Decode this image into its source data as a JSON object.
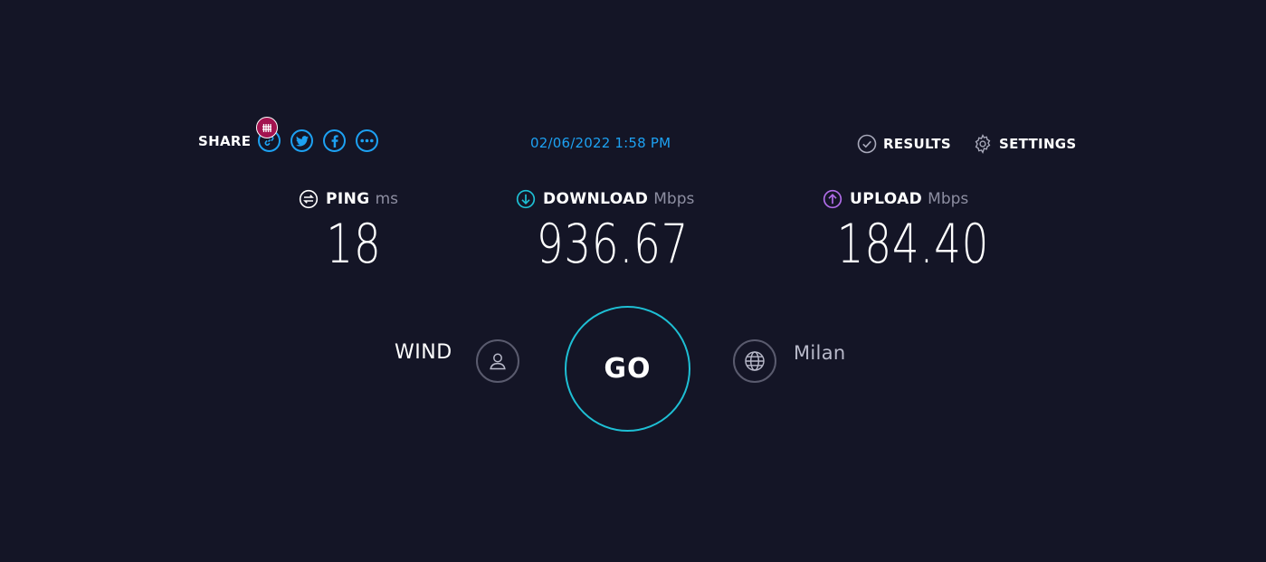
{
  "share": {
    "label": "SHARE",
    "buttons": [
      {
        "icon": "link-icon"
      },
      {
        "icon": "twitter-icon"
      },
      {
        "icon": "facebook-icon"
      },
      {
        "icon": "more-icon"
      }
    ],
    "badge_icon": "fence-icon"
  },
  "timestamp": "02/06/2022 1:58 PM",
  "nav": {
    "results_label": "RESULTS",
    "settings_label": "SETTINGS"
  },
  "metrics": {
    "ping": {
      "label": "PING",
      "unit": "ms",
      "value": "18",
      "icon": "ping-icon"
    },
    "download": {
      "label": "DOWNLOAD",
      "unit": "Mbps",
      "value": "936.67",
      "icon": "download-icon"
    },
    "upload": {
      "label": "UPLOAD",
      "unit": "Mbps",
      "value": "184.40",
      "icon": "upload-icon"
    }
  },
  "provider": {
    "name": "WIND",
    "icon": "user-icon"
  },
  "go_label": "GO",
  "server": {
    "name": "Milan",
    "icon": "globe-icon"
  },
  "colors": {
    "background": "#141526",
    "accent_blue": "#1da1f2",
    "download_teal": "#1ebfd4",
    "upload_purple": "#b06ce8",
    "badge": "#a3134f"
  }
}
